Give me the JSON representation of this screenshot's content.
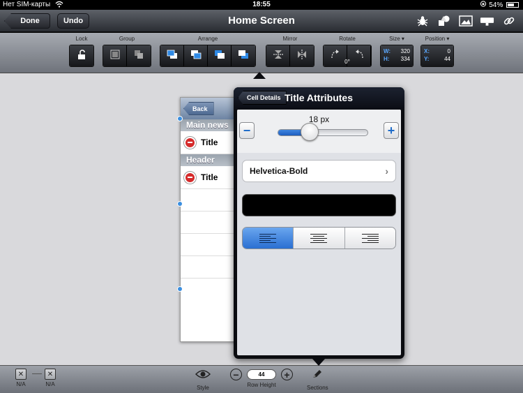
{
  "status": {
    "carrier": "Нет SIM-карты",
    "time": "18:55",
    "battery": "54%",
    "battery_level": 0.54
  },
  "nav": {
    "done_label": "Done",
    "undo_label": "Undo",
    "title": "Home Screen",
    "icons": [
      "bug-icon",
      "shapes-icon",
      "image-icon",
      "keyboard-icon",
      "link-icon"
    ]
  },
  "toolbar": {
    "lock_label": "Lock",
    "group_label": "Group",
    "arrange_label": "Arrange",
    "mirror_label": "Mirror",
    "rotate_label": "Rotate",
    "rotate_value": "0°",
    "size_label": "Size ▾",
    "size_w": "320",
    "size_h": "334",
    "position_label": "Position ▾",
    "pos_x": "0",
    "pos_y": "44",
    "axis_w": "W:",
    "axis_h": "H:",
    "axis_x": "X:",
    "axis_y": "Y:"
  },
  "phone": {
    "back_label": "Back",
    "section1": "Main news",
    "row1": "Title",
    "section2": "Header",
    "row2": "Title"
  },
  "popover": {
    "back_label": "Cell Details",
    "title": "Title Attributes",
    "font_size": "18 px",
    "minus": "−",
    "plus": "+",
    "slider_value": 0.35,
    "font_name": "Helvetica-Bold",
    "color": "#000000",
    "alignment_options": [
      "left",
      "center",
      "right"
    ],
    "alignment_selected": "left"
  },
  "bottom": {
    "na1": "N/A",
    "na2": "N/A",
    "style_label": "Style",
    "row_height_label": "Row Height",
    "row_height_value": "44",
    "sections_label": "Sections"
  },
  "colors": {
    "accent": "#2a6fd2",
    "nav_dark": "#2a2d33",
    "canvas": "#d9d9dc"
  }
}
